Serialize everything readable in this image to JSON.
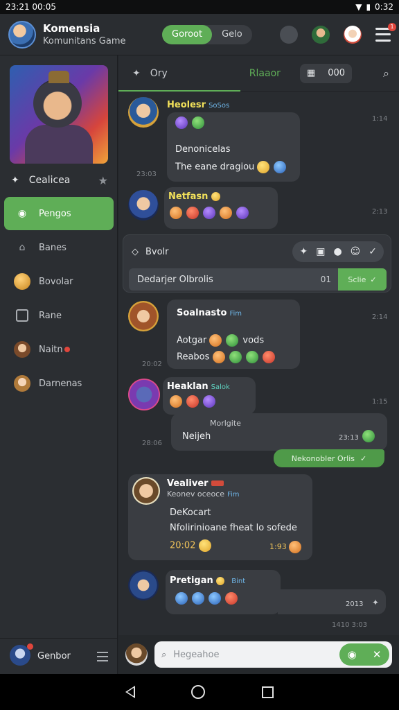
{
  "status_bar": {
    "time": "23:21 00:05",
    "battery": "0:32"
  },
  "header": {
    "title": "Komensia",
    "subtitle": "Komunitans Game",
    "seg_active": "Goroot",
    "seg_inactive": "Gelo",
    "menu_badge": "1"
  },
  "sidebar": {
    "heading": "Cealicea",
    "items": [
      {
        "label": "Pengos"
      },
      {
        "label": "Banes"
      },
      {
        "label": "Bovolar"
      },
      {
        "label": "Rane"
      },
      {
        "label": "Naitn"
      },
      {
        "label": "Darnenas"
      }
    ],
    "footer_label": "Genbor",
    "footer_badge": "1"
  },
  "chat": {
    "tabs": {
      "first": "Ory",
      "second": "Rlaaor",
      "pill_value": "000"
    },
    "messages": [
      {
        "name": "Heolesr",
        "tag": "SoSos",
        "text1": "Denonicelas",
        "text2": "The eane dragiou",
        "time_left": "23:03",
        "time_right": "1:14"
      },
      {
        "name": "Netfasn",
        "time_right": "2:13"
      },
      {
        "name": "Soalnasto",
        "tag": "Fim",
        "text1": "Aotgar",
        "text1b": "vods",
        "text2": "Reabos",
        "time_left": "20:02",
        "time_right": "2:14"
      },
      {
        "name": "Heaklan",
        "tag": "Salok",
        "time_right": "1:15"
      },
      {
        "name": "Vealiver",
        "tag": "Fim",
        "sub": "Keonev oceoce",
        "text1": "DeKocart",
        "text2": "Nfolirinioane fheat lo sofede",
        "amount_left": "20:02",
        "amount_right": "1:93"
      },
      {
        "name": "Pretigan",
        "tag": "Bint",
        "time_right": "2013"
      }
    ],
    "quote": {
      "label": "Bvolr",
      "text": "Dedarjer Olbrolis",
      "num": "01",
      "action": "Sclie"
    },
    "reply": {
      "top": "Morlgite",
      "text": "Neijeh",
      "time": "23:13",
      "time_left": "28:06"
    },
    "green_strip": "Nekonobler Orlis",
    "bottom_time": "1410 3:03"
  },
  "composer": {
    "placeholder": "Hegeahoe"
  }
}
